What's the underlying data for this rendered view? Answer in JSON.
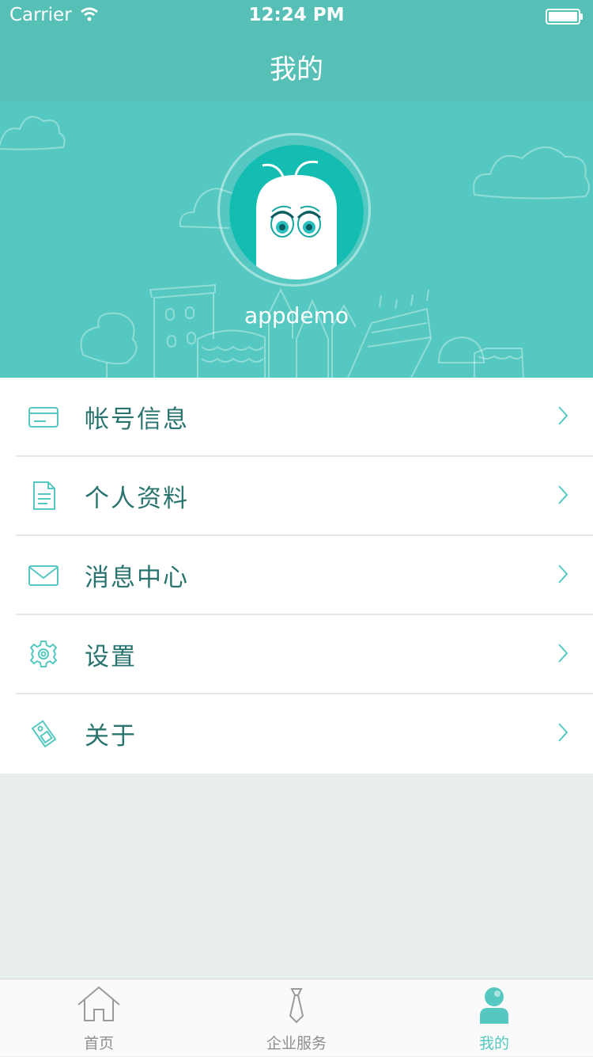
{
  "status_bar": {
    "carrier": "Carrier",
    "time": "12:24 PM"
  },
  "nav": {
    "title": "我的"
  },
  "profile": {
    "username": "appdemo"
  },
  "menu": {
    "items": [
      {
        "label": "帐号信息",
        "icon": "card-icon"
      },
      {
        "label": "个人资料",
        "icon": "document-icon"
      },
      {
        "label": "消息中心",
        "icon": "envelope-icon"
      },
      {
        "label": "设置",
        "icon": "gear-icon"
      },
      {
        "label": "关于",
        "icon": "tag-icon"
      }
    ]
  },
  "tabs": [
    {
      "label": "首页",
      "icon": "home-icon"
    },
    {
      "label": "企业服务",
      "icon": "tie-icon"
    },
    {
      "label": "我的",
      "icon": "person-icon",
      "active": true
    }
  ],
  "colors": {
    "accent": "#55c9c1",
    "nav": "#56bfb6",
    "text": "#2a7470",
    "background": "#e9eeee"
  }
}
